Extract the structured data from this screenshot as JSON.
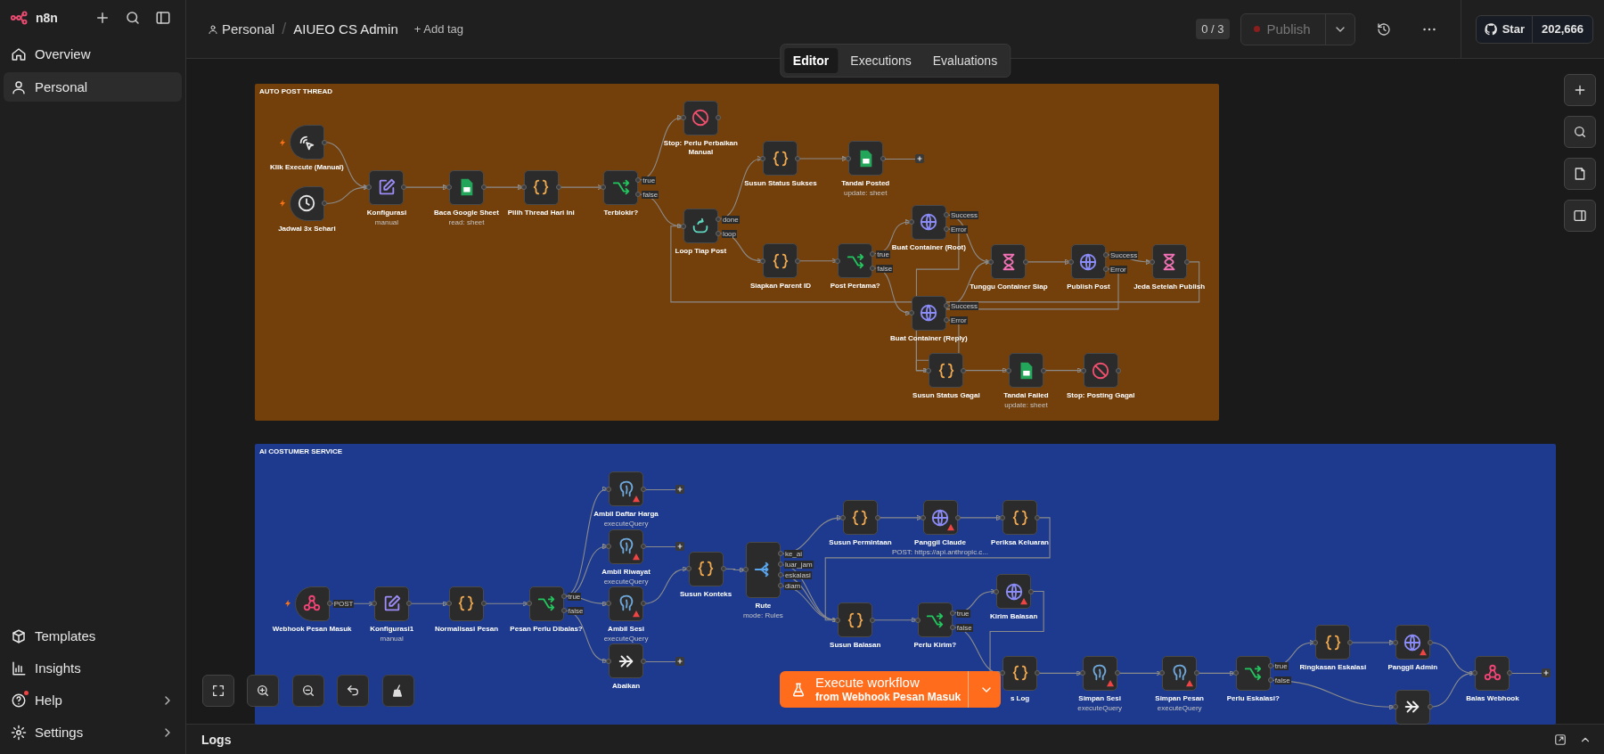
{
  "sidebar": {
    "brand": "n8n",
    "items": [
      {
        "label": "Overview",
        "selected": false
      },
      {
        "label": "Personal",
        "selected": true
      }
    ],
    "footer_items": [
      {
        "label": "Templates",
        "badge": false,
        "submenu": false
      },
      {
        "label": "Insights",
        "badge": false,
        "submenu": false
      },
      {
        "label": "Help",
        "badge": true,
        "submenu": true
      },
      {
        "label": "Settings",
        "badge": false,
        "submenu": true
      }
    ]
  },
  "header": {
    "project": "Personal",
    "separator": "/",
    "workflow": "AIUEO CS Admin",
    "add_tag": "+ Add tag",
    "counter": "0 / 3",
    "publish": {
      "label": "Publish",
      "disabled": true
    },
    "github": {
      "label": "Star",
      "count": "202,666"
    }
  },
  "tabs": [
    {
      "label": "Editor",
      "selected": true
    },
    {
      "label": "Executions",
      "selected": false
    },
    {
      "label": "Evaluations",
      "selected": false
    }
  ],
  "groups": [
    {
      "title": "AUTO POST THREAD",
      "color": "#733f0b",
      "nodes": [
        {
          "label": "Klik Execute (Manual)",
          "kind": "manual-trigger",
          "warning": false,
          "open_end": false
        },
        {
          "label": "Jadwal 3x Sehari",
          "kind": "schedule-trigger",
          "warning": false,
          "open_end": false
        },
        {
          "label": "Konfigurasi",
          "subtitle": "manual",
          "kind": "set",
          "warning": false,
          "open_end": false
        },
        {
          "label": "Baca Google Sheet",
          "subtitle": "read: sheet",
          "kind": "sheets",
          "warning": false,
          "open_end": false
        },
        {
          "label": "Pilih Thread Hari Ini",
          "kind": "code",
          "warning": false,
          "open_end": false
        },
        {
          "label": "Terblokir?",
          "kind": "if",
          "outputs": [
            "true",
            "false"
          ],
          "warning": false,
          "open_end": false
        },
        {
          "label": "Stop: Perlu Perbaikan Manual",
          "kind": "stop",
          "warning": false,
          "open_end": false
        },
        {
          "label": "Susun Status Sukses",
          "kind": "code",
          "warning": false,
          "open_end": false
        },
        {
          "label": "Tandai Posted",
          "subtitle": "update: sheet",
          "kind": "sheets",
          "warning": false,
          "open_end": true
        },
        {
          "label": "Loop Tiap Post",
          "kind": "loop",
          "outputs": [
            "done",
            "loop"
          ],
          "warning": false,
          "open_end": false
        },
        {
          "label": "Siapkan Parent ID",
          "kind": "code",
          "warning": false,
          "open_end": false
        },
        {
          "label": "Post Pertama?",
          "kind": "if",
          "outputs": [
            "true",
            "false"
          ],
          "warning": false,
          "open_end": false
        },
        {
          "label": "Buat Container (Root)",
          "kind": "http",
          "outputs": [
            "Success",
            "Error"
          ],
          "warning": false,
          "open_end": false
        },
        {
          "label": "Tunggu Container Siap",
          "kind": "wait",
          "warning": false,
          "open_end": false
        },
        {
          "label": "Publish Post",
          "kind": "http",
          "outputs": [
            "Success",
            "Error"
          ],
          "warning": false,
          "open_end": false
        },
        {
          "label": "Jeda Setelah Publish",
          "kind": "wait",
          "warning": false,
          "open_end": false
        },
        {
          "label": "Buat Container (Reply)",
          "kind": "http",
          "outputs": [
            "Success",
            "Error"
          ],
          "warning": false,
          "open_end": false
        },
        {
          "label": "Susun Status Gagal",
          "kind": "code",
          "warning": false,
          "open_end": false
        },
        {
          "label": "Tandai Failed",
          "subtitle": "update: sheet",
          "kind": "sheets",
          "warning": false,
          "open_end": false
        },
        {
          "label": "Stop: Posting Gagal",
          "kind": "stop",
          "warning": false,
          "open_end": false
        }
      ]
    },
    {
      "title": "AI COSTUMER SERVICE",
      "color": "#1d3a8e",
      "nodes": [
        {
          "label": "Webhook Pesan Masuk",
          "kind": "webhook-trigger",
          "outputs": [
            "POST"
          ],
          "warning": false,
          "open_end": false
        },
        {
          "label": "Konfigurasi1",
          "subtitle": "manual",
          "kind": "set",
          "warning": false,
          "open_end": false
        },
        {
          "label": "Normalisasi Pesan",
          "kind": "code",
          "warning": false,
          "open_end": false
        },
        {
          "label": "Pesan Perlu Dibalas?",
          "kind": "if",
          "outputs": [
            "true",
            "false"
          ],
          "warning": false,
          "open_end": false
        },
        {
          "label": "Ambil Daftar Harga",
          "subtitle": "executeQuery",
          "kind": "postgres",
          "warning": true,
          "open_end": true
        },
        {
          "label": "Ambil Riwayat",
          "subtitle": "executeQuery",
          "kind": "postgres",
          "warning": true,
          "open_end": true
        },
        {
          "label": "Ambil Sesi",
          "subtitle": "executeQuery",
          "kind": "postgres",
          "warning": true,
          "open_end": false
        },
        {
          "label": "Abaikan",
          "kind": "noop",
          "warning": false,
          "open_end": true
        },
        {
          "label": "Susun Konteks",
          "kind": "code",
          "warning": false,
          "open_end": false
        },
        {
          "label": "Rute",
          "subtitle": "mode: Rules",
          "kind": "switch",
          "outputs": [
            "ke_ai",
            "luar_jam",
            "eskalasi",
            "diam"
          ],
          "warning": false,
          "open_end": false
        },
        {
          "label": "Susun Permintaan",
          "kind": "code",
          "warning": false,
          "open_end": false
        },
        {
          "label": "Panggil Claude",
          "subtitle": "POST: https://api.anthropic.c...",
          "kind": "http",
          "warning": true,
          "open_end": false
        },
        {
          "label": "Periksa Keluaran",
          "kind": "code",
          "warning": false,
          "open_end": false
        },
        {
          "label": "Susun Balasan",
          "kind": "code",
          "warning": false,
          "open_end": false
        },
        {
          "label": "Perlu Kirim?",
          "kind": "if",
          "outputs": [
            "true",
            "false"
          ],
          "warning": false,
          "open_end": false
        },
        {
          "label": "Kirim Balasan",
          "kind": "http",
          "warning": true,
          "open_end": false
        },
        {
          "label": "s Log",
          "kind": "code",
          "warning": false,
          "open_end": false
        },
        {
          "label": "Simpan Sesi",
          "subtitle": "executeQuery",
          "kind": "postgres",
          "warning": true,
          "open_end": false
        },
        {
          "label": "Simpan Pesan",
          "subtitle": "executeQuery",
          "kind": "postgres",
          "warning": true,
          "open_end": false
        },
        {
          "label": "Perlu Eskalasi?",
          "kind": "if",
          "outputs": [
            "true",
            "false"
          ],
          "warning": false,
          "open_end": false
        },
        {
          "label": "Ringkasan Eskalasi",
          "kind": "code",
          "warning": false,
          "open_end": false
        },
        {
          "label": "Panggil Admin",
          "kind": "http",
          "warning": true,
          "open_end": false
        },
        {
          "kind": "noop",
          "warning": false,
          "open_end": false
        },
        {
          "label": "Balas Webhook",
          "kind": "webhook",
          "warning": false,
          "open_end": true
        }
      ]
    }
  ],
  "execute": {
    "label": "Execute workflow",
    "source": "from Webhook Pesan Masuk"
  },
  "logs": {
    "label": "Logs"
  }
}
